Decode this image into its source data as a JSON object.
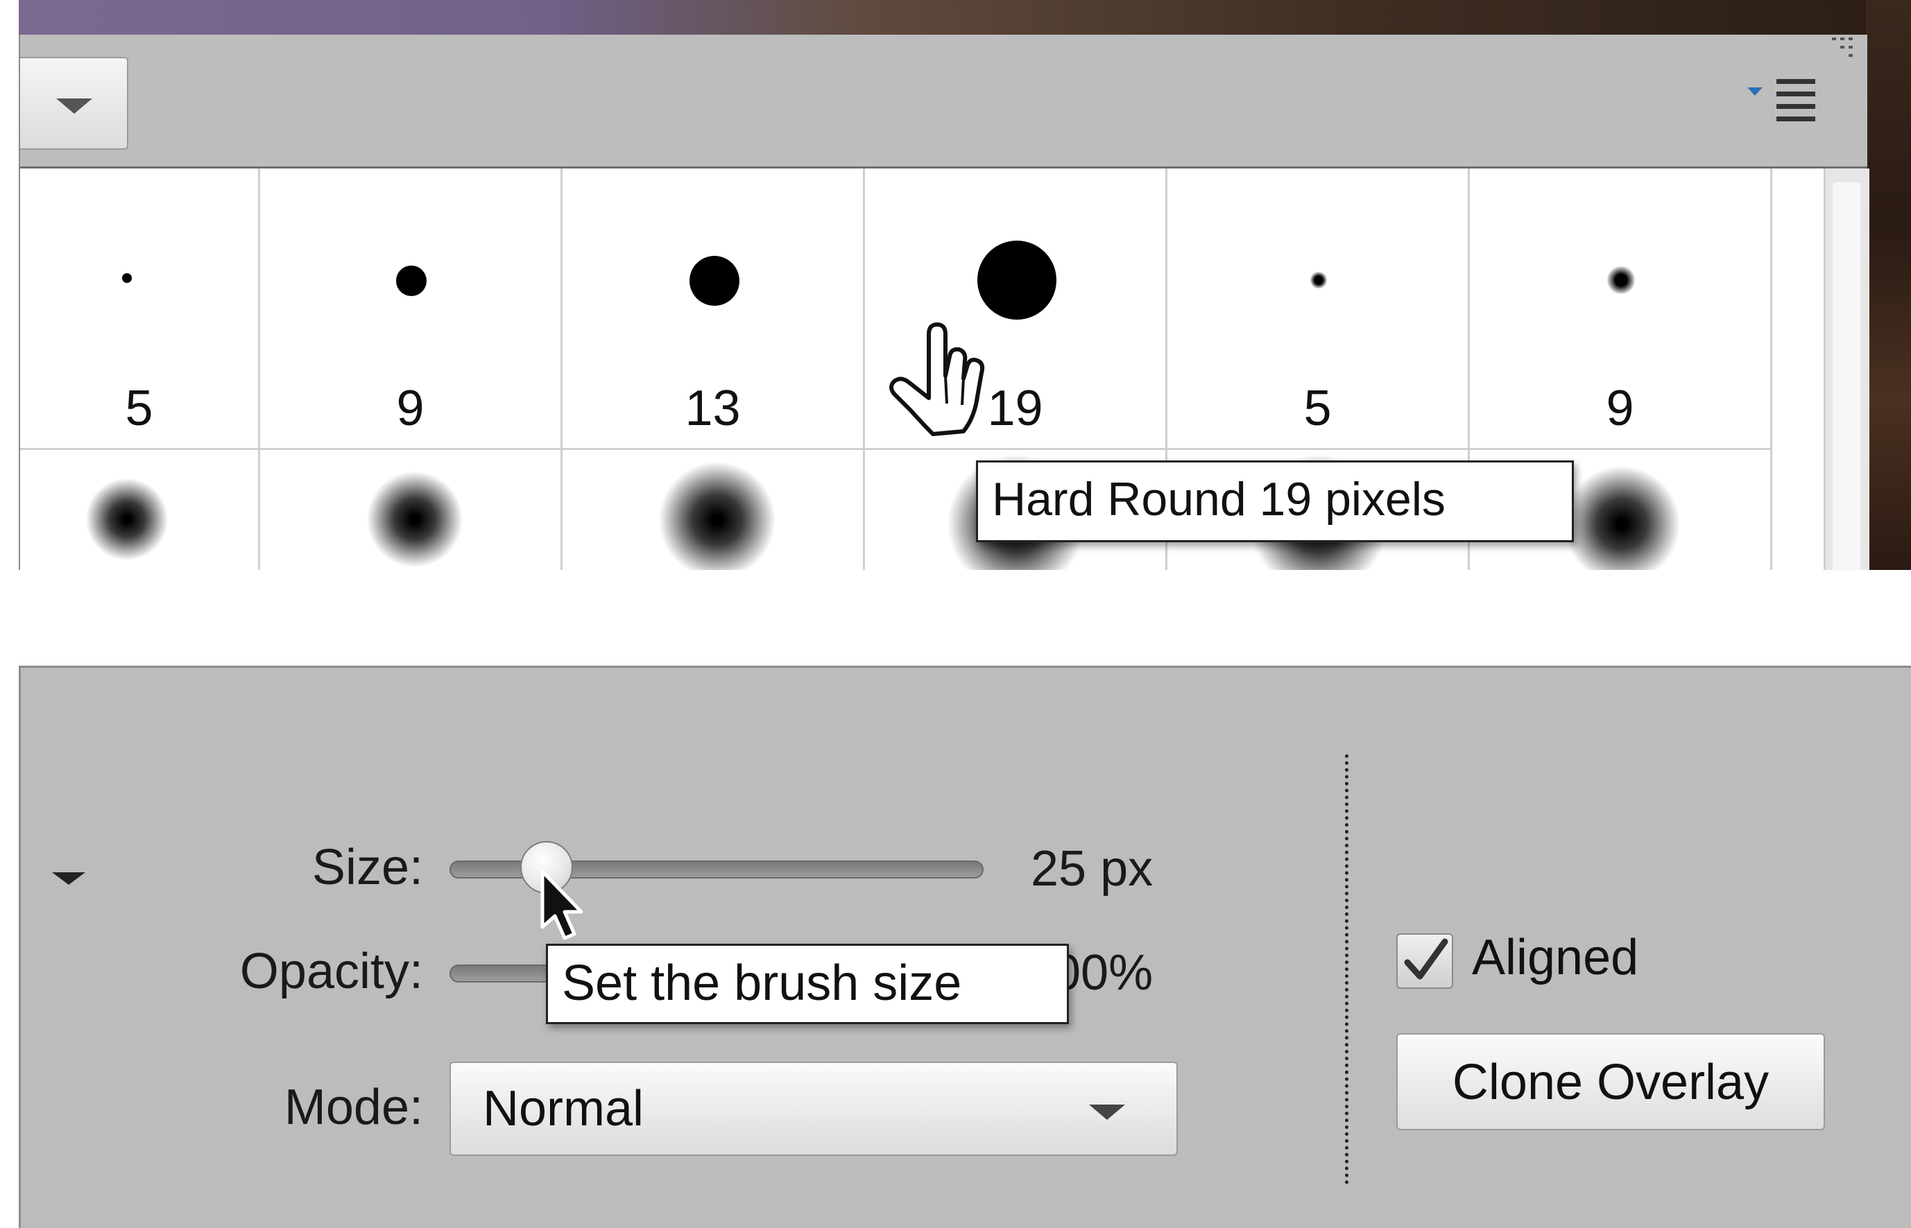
{
  "brush_picker": {
    "brushes_row1": [
      {
        "size": "5"
      },
      {
        "size": "9"
      },
      {
        "size": "13"
      },
      {
        "size": "19"
      },
      {
        "size": "5"
      },
      {
        "size": "9"
      }
    ],
    "tooltip": "Hard Round 19 pixels",
    "menu_icon": "panel-menu-icon",
    "dropdown_icon": "chevron-down-icon"
  },
  "tool_options": {
    "size_label": "Size:",
    "size_value": "25 px",
    "size_slider_fraction": 0.19,
    "opacity_label": "Opacity:",
    "opacity_value_visible": "00%",
    "opacity_slider_fraction": 1.0,
    "size_tooltip": "Set the brush size",
    "mode_label": "Mode:",
    "mode_value": "Normal",
    "aligned_label": "Aligned",
    "aligned_checked": true,
    "clone_overlay_label": "Clone Overlay"
  },
  "colors": {
    "panel_bg": "#bcbcbc",
    "grid_bg": "#ffffff",
    "tooltip_border": "#222222"
  }
}
